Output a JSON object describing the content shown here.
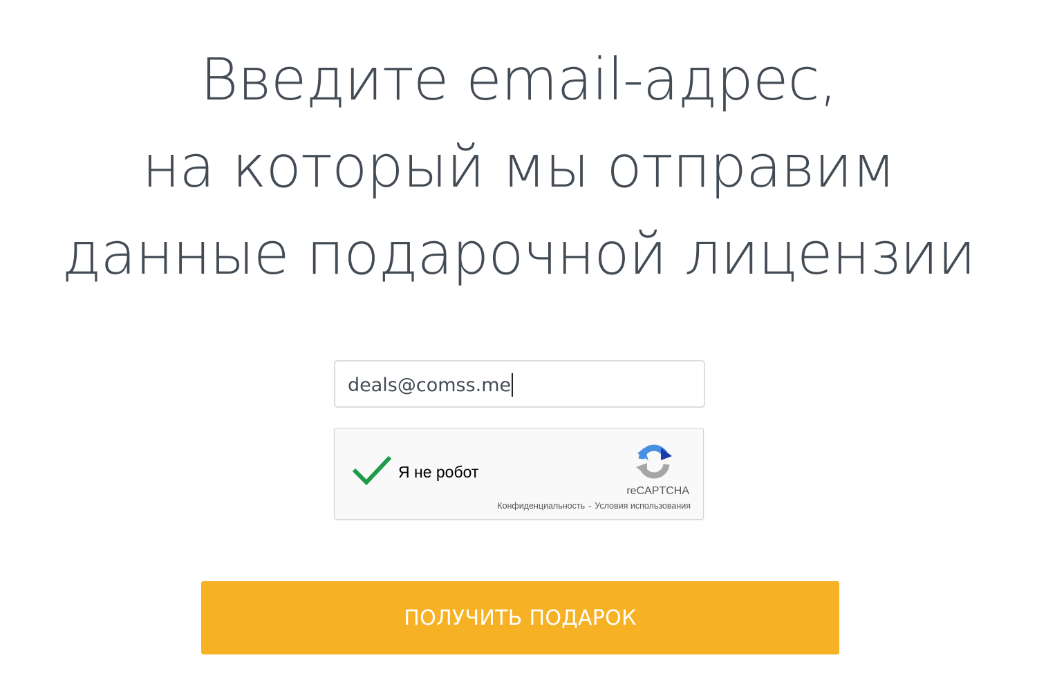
{
  "headline": {
    "line1": "Введите email-адрес,",
    "line2": "на который мы отправим",
    "line3": "данные подарочной лицензии"
  },
  "email": {
    "value": "deals@comss.me"
  },
  "captcha": {
    "label": "Я не робот",
    "brand": "reCAPTCHA",
    "privacy_link": "Конфиденциальность",
    "separator": "-",
    "terms_link": "Условия использования",
    "checked": true
  },
  "submit": {
    "label": "ПОЛУЧИТЬ ПОДАРОК"
  },
  "colors": {
    "heading_text": "#434b55",
    "button_bg": "#f6b224",
    "button_text": "#ffffff",
    "check_green": "#1e9a48"
  },
  "icons": {
    "check": "checkmark-icon",
    "recaptcha": "recaptcha-logo-icon"
  }
}
